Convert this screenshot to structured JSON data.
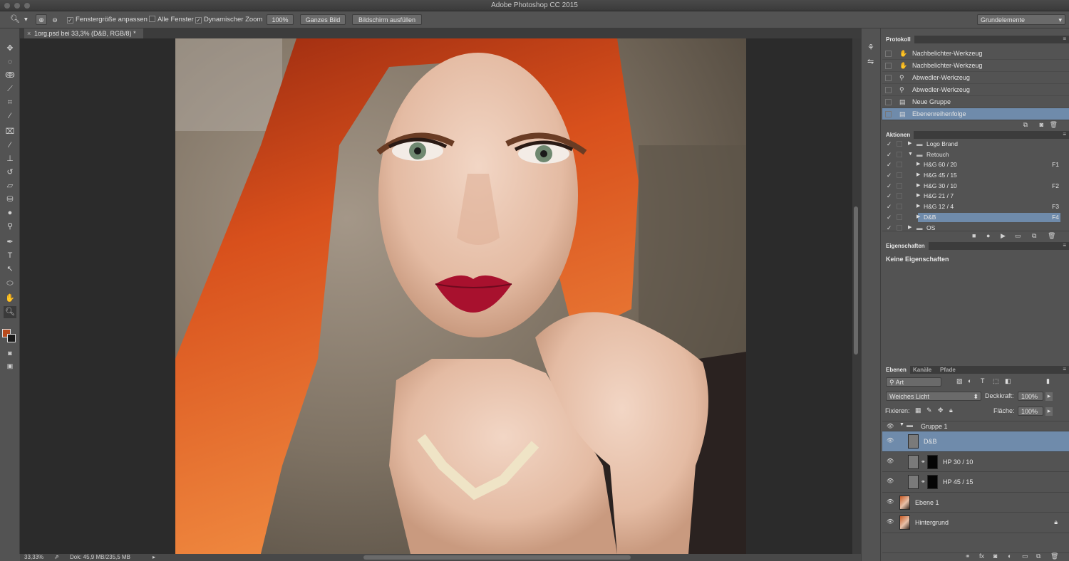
{
  "app": {
    "title": "Adobe Photoshop CC 2015"
  },
  "options": {
    "fit_window": "Fenstergröße anpassen",
    "all_windows": "Alle Fenster",
    "scrubby_zoom": "Dynamischer Zoom",
    "zoom_value": "100%",
    "fit_screen": "Ganzes Bild",
    "fill_screen": "Bildschirm ausfüllen",
    "workspace": "Grundelemente"
  },
  "document": {
    "tab": "1org.psd bei 33,3% (D&B, RGB/8) *"
  },
  "status": {
    "zoom": "33,33%",
    "doc_size": "Dok: 45,9 MB/235,5 MB"
  },
  "history": {
    "title": "Protokoll",
    "items": [
      {
        "label": "Nachbelichter-Werkzeug",
        "icon": "burn-icon"
      },
      {
        "label": "Nachbelichter-Werkzeug",
        "icon": "burn-icon"
      },
      {
        "label": "Abwedler-Werkzeug",
        "icon": "dodge-icon"
      },
      {
        "label": "Abwedler-Werkzeug",
        "icon": "dodge-icon"
      },
      {
        "label": "Neue Gruppe",
        "icon": "document-icon"
      },
      {
        "label": "Ebenenreihenfolge",
        "icon": "document-icon"
      }
    ]
  },
  "actions": {
    "title": "Aktionen",
    "items": [
      {
        "label": "Logo Brand",
        "key": "",
        "indent": 1,
        "folder": true
      },
      {
        "label": "Retouch",
        "key": "",
        "indent": 1,
        "folder": true
      },
      {
        "label": "H&G 60 / 20",
        "key": "F1",
        "indent": 2,
        "folder": false
      },
      {
        "label": "H&G 45 / 15",
        "key": "",
        "indent": 2,
        "folder": false
      },
      {
        "label": "H&G 30 / 10",
        "key": "F2",
        "indent": 2,
        "folder": false
      },
      {
        "label": "H&G 21 / 7",
        "key": "",
        "indent": 2,
        "folder": false
      },
      {
        "label": "H&G 12 / 4",
        "key": "F3",
        "indent": 2,
        "folder": false
      },
      {
        "label": "D&B",
        "key": "F4",
        "indent": 2,
        "folder": false
      },
      {
        "label": "OS",
        "key": "",
        "indent": 1,
        "folder": true
      }
    ]
  },
  "properties": {
    "title": "Eigenschaften",
    "empty": "Keine Eigenschaften"
  },
  "layers": {
    "tabs": [
      "Ebenen",
      "Kanäle",
      "Pfade"
    ],
    "filter": "Art",
    "blend_mode": "Weiches Licht",
    "opacity_label": "Deckkraft:",
    "opacity": "100%",
    "lock_label": "Fixieren:",
    "fill_label": "Fläche:",
    "fill": "100%",
    "items": [
      {
        "label": "Gruppe 1",
        "type": "group"
      },
      {
        "label": "D&B",
        "type": "gray"
      },
      {
        "label": "HP 30 / 10",
        "type": "mask"
      },
      {
        "label": "HP 45 / 15",
        "type": "mask"
      },
      {
        "label": "Ebene 1",
        "type": "photo"
      },
      {
        "label": "Hintergrund",
        "type": "photo"
      }
    ]
  },
  "colors": {
    "foreground": "#b84a1c",
    "background": "#1a1a1a",
    "selection": "#6f8bab"
  }
}
